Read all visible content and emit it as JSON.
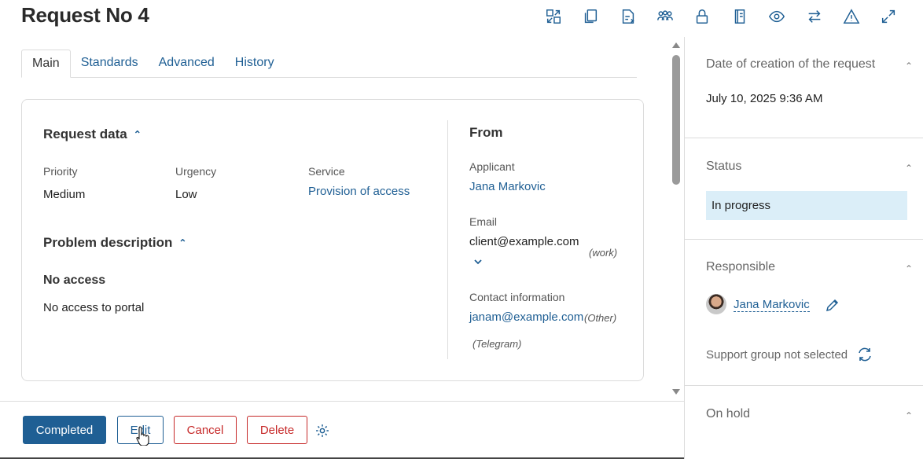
{
  "page": {
    "title": "Request No 4"
  },
  "toolbar": {
    "icons": [
      "transfer-icon",
      "copy-icon",
      "file-export-icon",
      "group-icon",
      "lock-icon",
      "book-icon",
      "eye-icon",
      "swap-icon",
      "warning-icon",
      "expand-icon"
    ]
  },
  "tabs": [
    {
      "label": "Main",
      "active": true
    },
    {
      "label": "Standards",
      "active": false
    },
    {
      "label": "Advanced",
      "active": false
    },
    {
      "label": "History",
      "active": false
    }
  ],
  "request_data": {
    "heading": "Request data",
    "priority_label": "Priority",
    "priority_value": "Medium",
    "urgency_label": "Urgency",
    "urgency_value": "Low",
    "service_label": "Service",
    "service_value": "Provision of access"
  },
  "problem": {
    "heading": "Problem description",
    "subject": "No access",
    "description": "No access to portal"
  },
  "from": {
    "heading": "From",
    "applicant_label": "Applicant",
    "applicant_value": "Jana Markovic",
    "email_label": "Email",
    "email_value": "client@example.com",
    "email_type": "(work)",
    "contact_label": "Contact information",
    "contact_value": "janam@example.com",
    "contact_type": "(Other)",
    "contact_extra_type": "(Telegram)"
  },
  "actions": {
    "completed": "Completed",
    "edit": "Edit",
    "cancel": "Cancel",
    "delete": "Delete"
  },
  "side": {
    "creation_heading": "Date of creation of the request",
    "creation_value": "July 10, 2025 9:36 AM",
    "status_heading": "Status",
    "status_value": "In progress",
    "responsible_heading": "Responsible",
    "responsible_name": "Jana Markovic",
    "support_group": "Support group not selected",
    "onhold_heading": "On hold"
  },
  "colors": {
    "accent": "#1f5f94",
    "danger": "#c62828",
    "status_bg": "#dbeef8"
  }
}
